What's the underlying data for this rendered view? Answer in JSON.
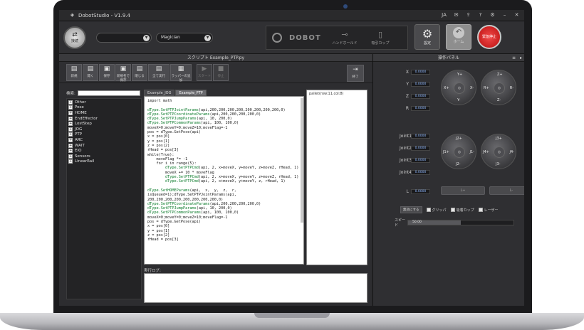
{
  "app": {
    "title": "DobotStudio - V1.9.4"
  },
  "titlebar": {
    "lang": "JA",
    "icons": [
      "mail-icon",
      "export-icon",
      "help-icon",
      "settings-icon",
      "minimize-icon",
      "close-icon"
    ]
  },
  "toolbar": {
    "connect_label": "接続",
    "port_value": "",
    "device_value": "Magician",
    "logo_text": "DOBOT",
    "tool1_label": "ハンドホールド",
    "tool2_label": "吸引カップ",
    "settings_label": "設定",
    "home_label": "ホーム",
    "estop_label": "緊急停止"
  },
  "script": {
    "title": "スクリプト  Example_PTP.py",
    "buttons": [
      {
        "icon": "new-icon",
        "label": "新規"
      },
      {
        "icon": "open-icon",
        "label": "開く"
      },
      {
        "icon": "save-icon",
        "label": "保存"
      },
      {
        "icon": "save-as-icon",
        "label": "新規名で保存"
      },
      {
        "icon": "close-icon",
        "label": "閉じる"
      },
      {
        "icon": "run-icon",
        "label": "全て実行"
      },
      {
        "icon": "grid-icon",
        "label": "ラッパーの追加"
      },
      {
        "icon": "start-icon",
        "label": "スタート"
      },
      {
        "icon": "stop-icon",
        "label": "停止"
      }
    ],
    "exit_label": "終了",
    "search_label": "検索:",
    "search_value": "",
    "commands": [
      "Other",
      "Pose",
      "HOME",
      "EndEffector",
      "LostStep",
      "JOG",
      "PTP",
      "ARC",
      "WAIT",
      "EIO",
      "Sensors",
      "LinearRail"
    ],
    "tabs": [
      "Example_JOG",
      "Example_PTP"
    ],
    "active_tab": "Example_PTP",
    "code": [
      "import math",
      "",
      "dType.SetPTPJointParams(api,200,200,200,200,200,200,200,200,0)",
      "dType.SetPTPCoordinateParams(api,200,200,200,200,0)",
      "dType.SetPTPJumpParams(api, 10, 200,0)",
      "dType.SetPTPCommonParams(api, 100, 100,0)",
      "moveX=0;moveY=0;moveZ=10;moveFlag=-1",
      "pos = dType.GetPose(api)",
      "x = pos[0]",
      "y = pos[1]",
      "z = pos[2]",
      "rHead = pos[3]",
      "while(True):",
      "    moveFlag *= -1",
      "    for i in range(5):",
      "        dType.SetPTPCmd(api, 2, x+moveX, y+moveY, z+moveZ, rHead, 1)",
      "        moveX += 10 * moveFlag",
      "        dType.SetPTPCmd(api, 2, x+moveX, y+moveY, z+moveZ, rHead, 1)",
      "        dType.SetPTPCmd(api, 2, x+moveX, y+moveY, z, rHead, 1)",
      "",
      "dType.SetHOMEParams(api,  x,  y,  z,  r,",
      "isQueued=1);dType.SetPTPJointParams(api,",
      "200,200,200,200,200,200,200,200,0)",
      "dType.SetPTPCoordinateParams(api,200,200,200,200,0)",
      "dType.SetPTPJumpParams(api, 10, 200,0)",
      "dType.SetPTPCommonParams(api, 100, 100,0)",
      "moveX=0;moveY=0;moveZ=10;moveFlag=-1",
      "pos = dType.GetPose(api)",
      "x = pos[0]",
      "y = pos[1]",
      "z = pos[2]",
      "rHead = pos[3]"
    ],
    "pallet_text": "pallet(row:11,col:8)",
    "log_label": "実行ログ:"
  },
  "op_panel": {
    "title": "操作パネル",
    "coords": [
      {
        "label": "X",
        "value": "0.0000"
      },
      {
        "label": "Y",
        "value": "0.0000"
      },
      {
        "label": "Z",
        "value": "0.0000"
      },
      {
        "label": "R",
        "value": "0.0000"
      }
    ],
    "joints": [
      {
        "label": "Joint1",
        "value": "0.0000"
      },
      {
        "label": "Joint2",
        "value": "0.0000"
      },
      {
        "label": "Joint3",
        "value": "0.0000"
      },
      {
        "label": "Joint4",
        "value": "0.0000"
      }
    ],
    "extra": {
      "label": "L",
      "value": "0.0000"
    },
    "jog_xy": {
      "top": "Y+",
      "bottom": "Y-",
      "left": "X+",
      "right": "X-"
    },
    "jog_zr": {
      "top": "Z+",
      "bottom": "Z-",
      "left": "R+",
      "right": "R-"
    },
    "jog_j12": {
      "top": "J2+",
      "bottom": "J2-",
      "left": "J1+",
      "right": "J1-"
    },
    "jog_j34": {
      "top": "J3+",
      "bottom": "J3-",
      "left": "J4+",
      "right": "J4-"
    },
    "l_plus": "L+",
    "l_minus": "L-",
    "option_btn": "無効にする",
    "opt1": "グリッパ",
    "opt2": "吸着カップ",
    "opt3": "レーザー",
    "speed_label": "スピード",
    "speed_value": "50.00",
    "speed_pct": 50
  }
}
